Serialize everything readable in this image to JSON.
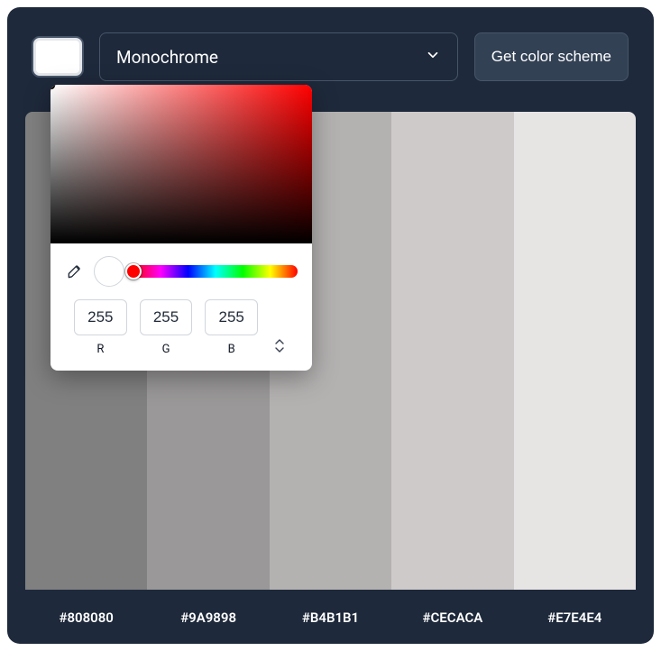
{
  "topbar": {
    "swatch_color": "#ffffff",
    "scheme_label": "Monochrome",
    "get_button": "Get color scheme"
  },
  "palette": [
    {
      "hex": "#808080"
    },
    {
      "hex": "#9A9898"
    },
    {
      "hex": "#B4B1B1"
    },
    {
      "hex": "#CECACA"
    },
    {
      "hex": "#E7E4E4"
    }
  ],
  "picker": {
    "rgb": {
      "r": "255",
      "g": "255",
      "b": "255"
    },
    "channel_labels": {
      "r": "R",
      "g": "G",
      "b": "B"
    },
    "hue_deg": 0,
    "current_color": "#ffffff"
  }
}
